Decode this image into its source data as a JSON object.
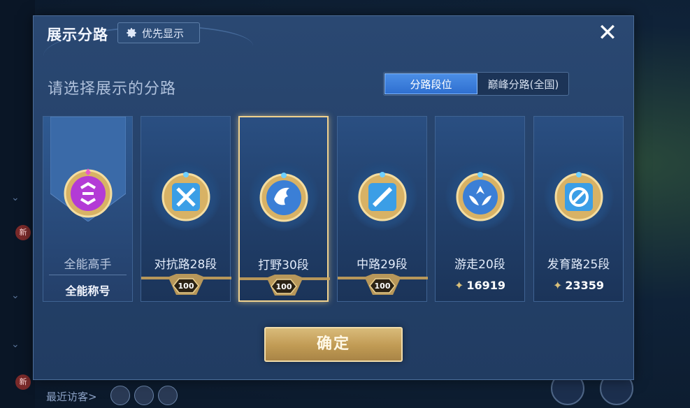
{
  "header": {
    "title": "展示分路",
    "priority_button_label": "优先显示",
    "close_label": "✕"
  },
  "subtitle": "请选择展示的分路",
  "toggle": {
    "options": [
      "分路段位",
      "巅峰分路(全国)"
    ],
    "selected": "分路段位"
  },
  "cards": [
    {
      "id": "all-round",
      "label": "全能高手",
      "sublabel": "全能称号",
      "selected": false,
      "medal_color": "#b33bd6"
    },
    {
      "id": "clash-lane",
      "label": "对抗路28段",
      "badge": "100",
      "selected": false,
      "medal_color": "#3b9ee6"
    },
    {
      "id": "jungle",
      "label": "打野30段",
      "badge": "100",
      "selected": true,
      "medal_color": "#3b9ee6"
    },
    {
      "id": "mid-lane",
      "label": "中路29段",
      "badge": "100",
      "selected": false,
      "medal_color": "#3b9ee6"
    },
    {
      "id": "roam",
      "label": "游走20段",
      "points": "16919",
      "selected": false,
      "medal_color": "#3b9ee6"
    },
    {
      "id": "farm-lane",
      "label": "发育路25段",
      "points": "23359",
      "selected": false,
      "medal_color": "#3b9ee6"
    }
  ],
  "confirm_label": "确定",
  "background": {
    "recent_visitors_label": "最近访客>",
    "new_badge": "新"
  },
  "colors": {
    "gold": "#f0d28e",
    "accent_blue": "#3f84e0",
    "panel": "#254268"
  }
}
